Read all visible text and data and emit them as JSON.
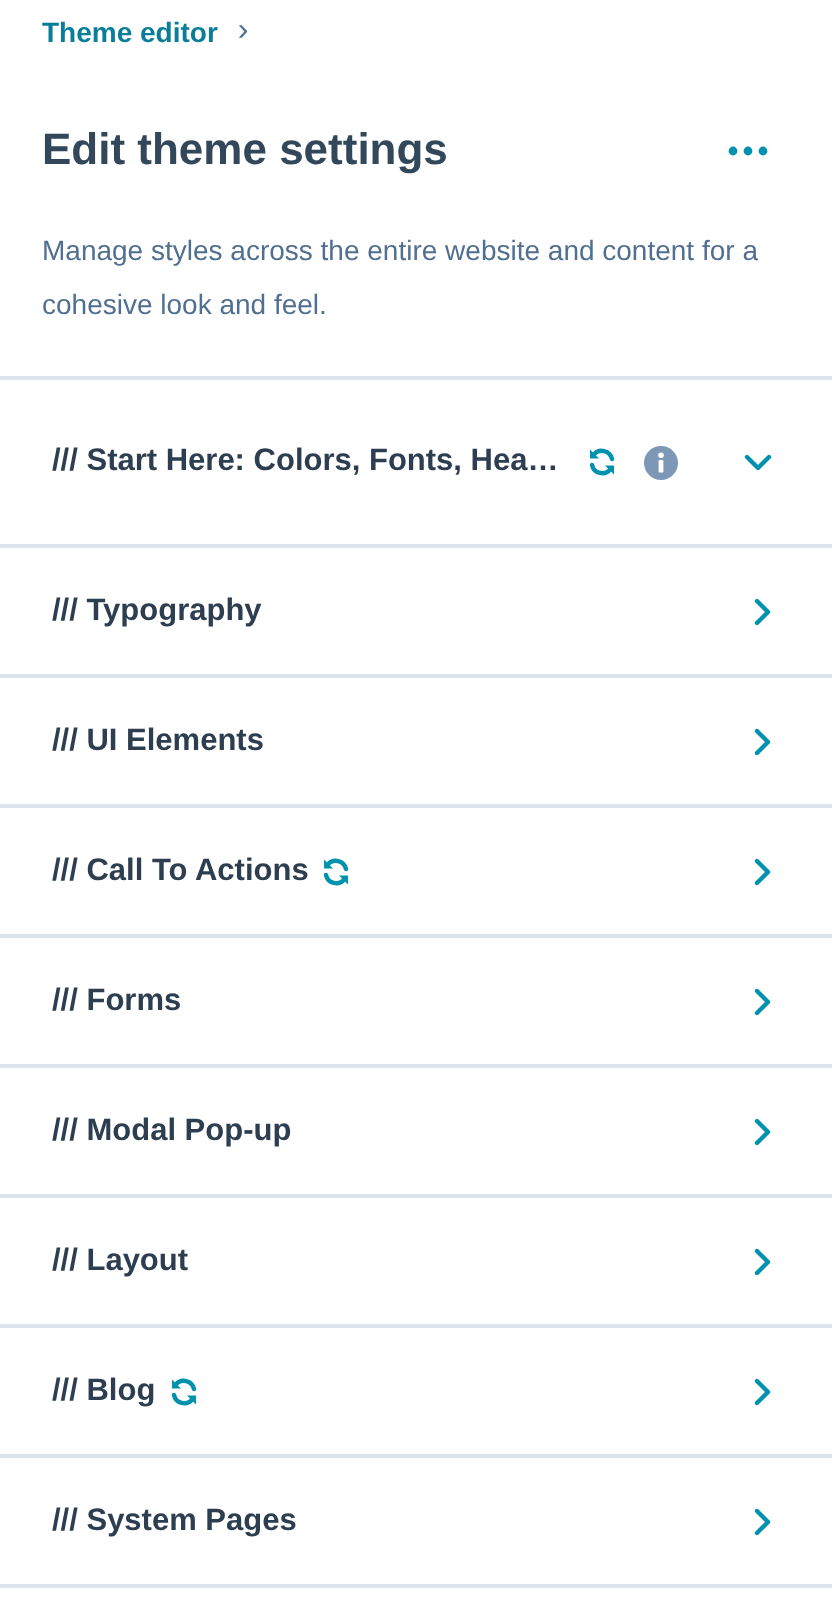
{
  "breadcrumb": {
    "label": "Theme editor",
    "chevron": "›"
  },
  "header": {
    "title": "Edit theme settings",
    "description": "Manage styles across the entire website and content for a cohesive look and feel."
  },
  "sections": [
    {
      "label": "/// Start Here: Colors, Fonts, Hea…",
      "synced": true,
      "info": true,
      "expanded": true
    },
    {
      "label": "/// Typography",
      "synced": false,
      "info": false,
      "expanded": false
    },
    {
      "label": "/// UI Elements",
      "synced": false,
      "info": false,
      "expanded": false
    },
    {
      "label": "/// Call To Actions",
      "synced": true,
      "info": false,
      "expanded": false
    },
    {
      "label": "/// Forms",
      "synced": false,
      "info": false,
      "expanded": false
    },
    {
      "label": "/// Modal Pop-up",
      "synced": false,
      "info": false,
      "expanded": false
    },
    {
      "label": "/// Layout",
      "synced": false,
      "info": false,
      "expanded": false
    },
    {
      "label": "/// Blog",
      "synced": true,
      "info": false,
      "expanded": false
    },
    {
      "label": "/// System Pages",
      "synced": false,
      "info": false,
      "expanded": false
    }
  ]
}
